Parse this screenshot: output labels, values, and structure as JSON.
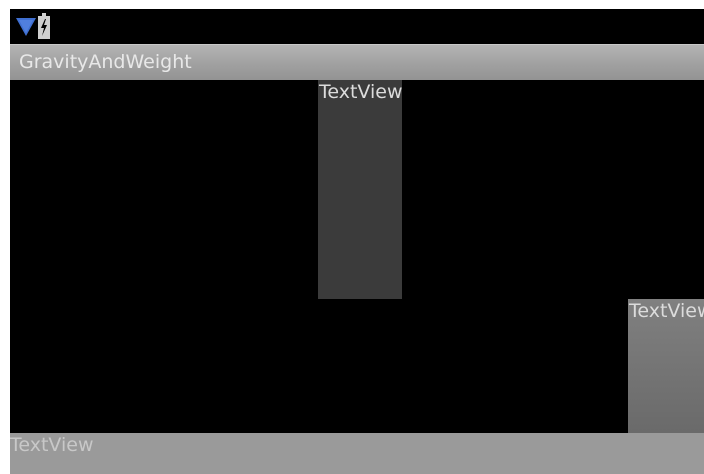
{
  "status_bar": {
    "icons": [
      "wifi-signal-icon",
      "battery-charging-icon"
    ]
  },
  "title_bar": {
    "title": "GravityAndWeight"
  },
  "content": {
    "textview_top": "TextView",
    "textview_right": "TextView",
    "textview_bottom": "TextView"
  },
  "colors": {
    "background": "#000000",
    "title_bar": "#a2a2a2",
    "textview_top_bg": "#3b3b3b",
    "textview_right_bg": "#777777",
    "textview_bottom_bg": "#9a9a9a",
    "wifi_icon": "#3f6fd1"
  }
}
